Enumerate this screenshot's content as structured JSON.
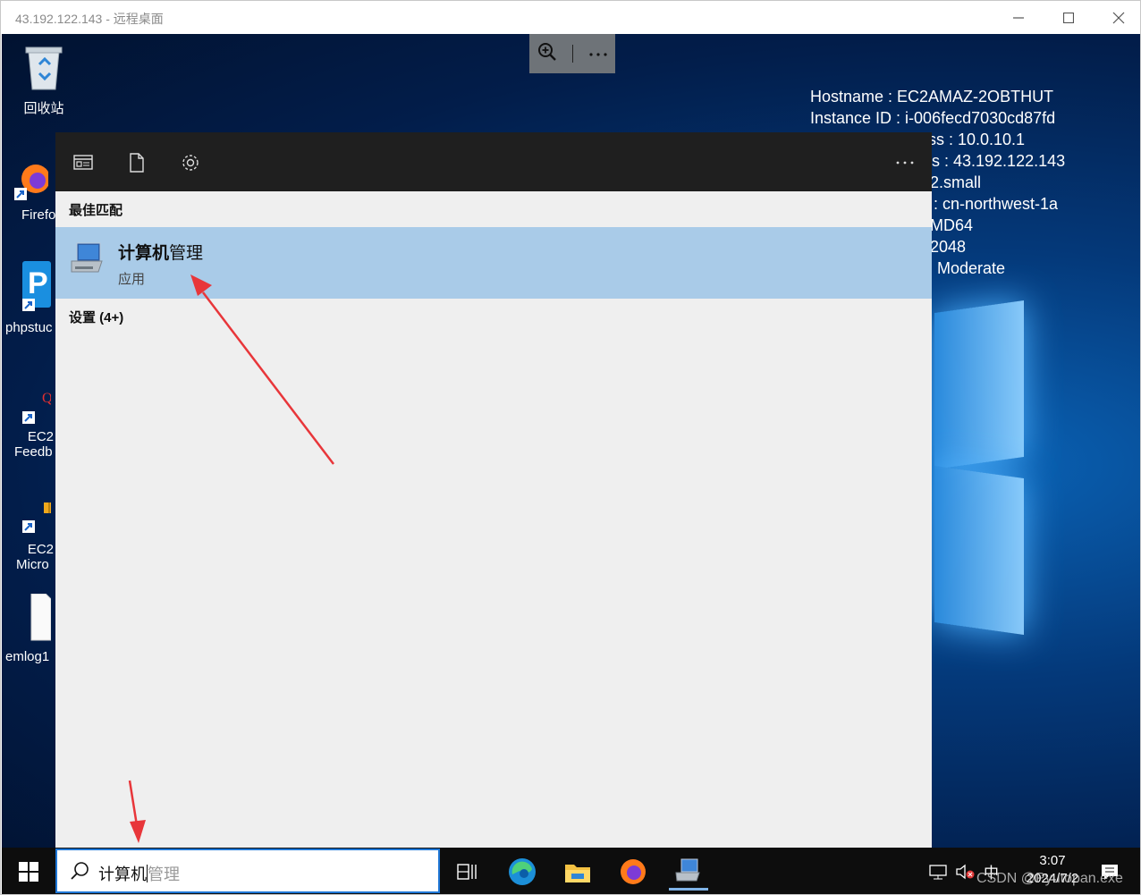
{
  "window": {
    "title": "43.192.122.143 - 远程桌面"
  },
  "sysinfo": [
    "Hostname : EC2AMAZ-2OBTHUT",
    "Instance ID : i-006fecd7030cd87fd",
    "ss : 10.0.10.1",
    "s : 43.192.122.143",
    "2.small",
    ": cn-northwest-1a",
    "MD64",
    "2048",
    "Moderate"
  ],
  "desktop_icons": {
    "recycle": "回收站",
    "firefox": "Firefo",
    "phpstudy": "phpstuc",
    "feedback_line1": "EC2",
    "feedback_line2": "Feedb",
    "micro_line1": "EC2",
    "micro_line2": "Micro",
    "emlog": "emlog1"
  },
  "search": {
    "best_match_label": "最佳匹配",
    "result_name_bold": "计算机",
    "result_name_rest": "管理",
    "result_type": "应用",
    "settings_label": "设置 (4+)",
    "query_typed": "计算机",
    "query_suggest": "管理"
  },
  "taskbar": {
    "ime": "中",
    "time": "3:07",
    "date": "2024/7/2",
    "watermark": "CSDN @Pyutopan.exe"
  },
  "colors": {
    "accent": "#1f77d6",
    "selected_bg": "#a9cbe8",
    "panel_bg": "#efefef",
    "topbar_bg": "#1f1f1f",
    "arrow": "#e8363a"
  }
}
